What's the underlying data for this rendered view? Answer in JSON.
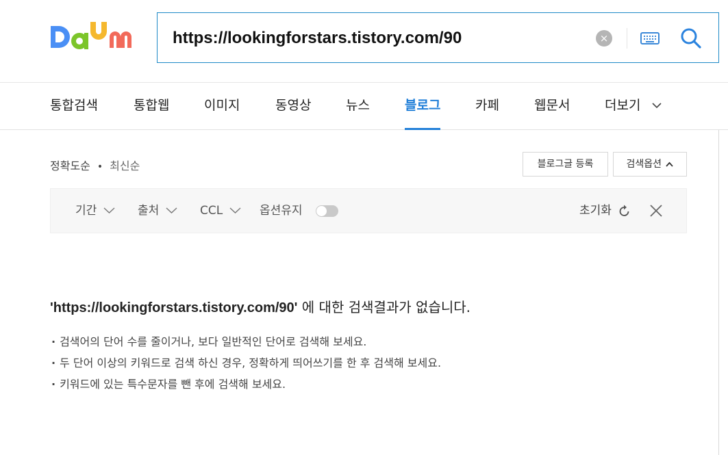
{
  "header": {
    "logo_text": "Daum",
    "search": {
      "value": "https://lookingforstars.tistory.com/90",
      "clear_symbol": "×"
    }
  },
  "tabs": [
    {
      "label": "통합검색"
    },
    {
      "label": "통합웹"
    },
    {
      "label": "이미지"
    },
    {
      "label": "동영상"
    },
    {
      "label": "뉴스"
    },
    {
      "label": "블로그"
    },
    {
      "label": "카페"
    },
    {
      "label": "웹문서"
    },
    {
      "label": "더보기"
    }
  ],
  "active_tab": "블로그",
  "sort": {
    "accuracy": "정확도순",
    "latest": "최신순"
  },
  "buttons": {
    "register_blog": "블로그글 등록",
    "search_options": "검색옵션"
  },
  "filters": {
    "period": "기간",
    "source": "출처",
    "ccl": "CCL",
    "keep_options": "옵션유지",
    "keep_options_on": false,
    "reset": "초기화"
  },
  "result": {
    "query_quoted": "'https://lookingforstars.tistory.com/90'",
    "message": "에 대한 검색결과가 없습니다.",
    "tips": [
      "검색어의 단어 수를 줄이거나, 보다 일반적인 단어로 검색해 보세요.",
      "두 단어 이상의 키워드로 검색 하신 경우, 정확하게 띄어쓰기를 한 후 검색해 보세요.",
      "키워드에 있는 특수문자를 뺀 후에 검색해 보세요."
    ]
  },
  "colors": {
    "accent": "#1f7ed8",
    "search_border": "#1e8ac7",
    "logo_d": "#4a8ff5",
    "logo_a": "#7cc52a",
    "logo_u": "#f5b82e",
    "logo_m": "#f26a5a"
  }
}
